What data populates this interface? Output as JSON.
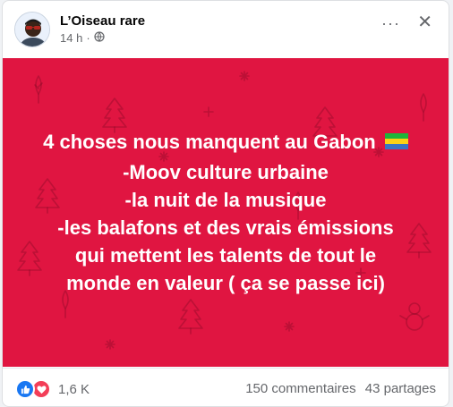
{
  "post": {
    "author": "L’Oiseau rare",
    "time": "14 h",
    "separator": "·",
    "privacy_icon": "globe-icon",
    "more_icon": "···",
    "close_icon": "✕"
  },
  "content": {
    "background": "#e01541",
    "lines": [
      "4 choses nous manquent au Gabon",
      "-Moov culture urbaine",
      "-la nuit de la musique",
      "-les balafons et des vrais émissions",
      "qui mettent les talents de tout le",
      "monde en valeur ( ça se passe ici)"
    ],
    "flag_icon": "gabon-flag-emoji"
  },
  "footer": {
    "reaction_count": "1,6 K",
    "comments": "150 commentaires",
    "shares": "43 partages",
    "reaction_icons": [
      "like-icon",
      "love-icon"
    ]
  }
}
